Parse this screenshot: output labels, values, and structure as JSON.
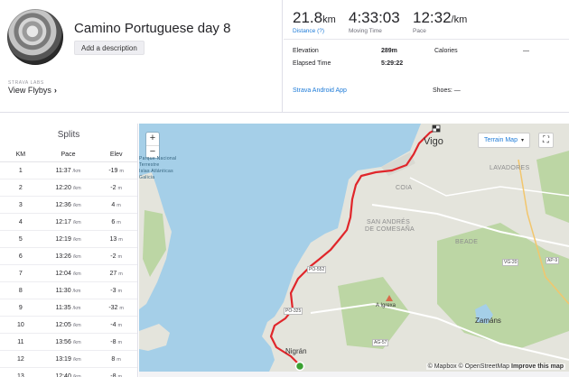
{
  "activity": {
    "title": "Camino Portuguese day 8",
    "add_description": "Add a description",
    "labs_label": "STRAVA LABS",
    "flybys_label": "View Flybys",
    "flybys_chevron": "›"
  },
  "stats": {
    "distance_value": "21.8",
    "distance_unit": "km",
    "distance_label": "Distance (?)",
    "moving_time_value": "4:33:03",
    "moving_time_label": "Moving Time",
    "pace_value": "12:32",
    "pace_unit": "/km",
    "pace_label": "Pace",
    "elevation_label": "Elevation",
    "elevation_value": "289m",
    "calories_label": "Calories",
    "calories_value": "—",
    "elapsed_label": "Elapsed Time",
    "elapsed_value": "5:29:22",
    "device": "Strava Android App",
    "shoes_label": "Shoes: —"
  },
  "splits": {
    "title": "Splits",
    "headers": [
      "KM",
      "Pace",
      "Elev"
    ],
    "pace_unit": "/km",
    "elev_unit": "m",
    "rows": [
      {
        "km": "1",
        "pace": "11:37",
        "elev": "-19"
      },
      {
        "km": "2",
        "pace": "12:20",
        "elev": "-2"
      },
      {
        "km": "3",
        "pace": "12:36",
        "elev": "4"
      },
      {
        "km": "4",
        "pace": "12:17",
        "elev": "6"
      },
      {
        "km": "5",
        "pace": "12:19",
        "elev": "13"
      },
      {
        "km": "6",
        "pace": "13:26",
        "elev": "-2"
      },
      {
        "km": "7",
        "pace": "12:04",
        "elev": "27"
      },
      {
        "km": "8",
        "pace": "11:30",
        "elev": "-3"
      },
      {
        "km": "9",
        "pace": "11:35",
        "elev": "-32"
      },
      {
        "km": "10",
        "pace": "12:05",
        "elev": "-4"
      },
      {
        "km": "11",
        "pace": "13:56",
        "elev": "-8"
      },
      {
        "km": "12",
        "pace": "13:19",
        "elev": "8"
      },
      {
        "km": "13",
        "pace": "12:40",
        "elev": "-8"
      }
    ]
  },
  "map": {
    "zoom_in": "+",
    "zoom_out": "−",
    "terrain_label": "Terrain Map",
    "terrain_caret": "▾",
    "fullscreen_icon": "⛶",
    "attribution": "© Mapbox © OpenStreetMap",
    "improve": "Improve this map",
    "places": {
      "vigo": "Vigo",
      "nigran": "Nigrán",
      "zamans": "Zamáns",
      "a_igrexa": "A Igrexa",
      "coia": "COIA",
      "san_andres": "SAN ANDRÉS",
      "de_comesana": "DE COMESAÑA",
      "lavadores": "LAVADORES",
      "beade": "BEADE",
      "parque": "Parque Nacional",
      "islas": "Islas Atlánticas",
      "galicia": "Galicia",
      "terrestre": "Terrestre"
    },
    "roads": [
      "PO-552",
      "PO-325",
      "AG-57",
      "VG-20",
      "AP-9"
    ],
    "colors": {
      "route": "#e0262b",
      "water": "#a5cfe8",
      "land": "#e4e4dc",
      "green": "#bcd6a4",
      "start": "#3aa132"
    }
  }
}
